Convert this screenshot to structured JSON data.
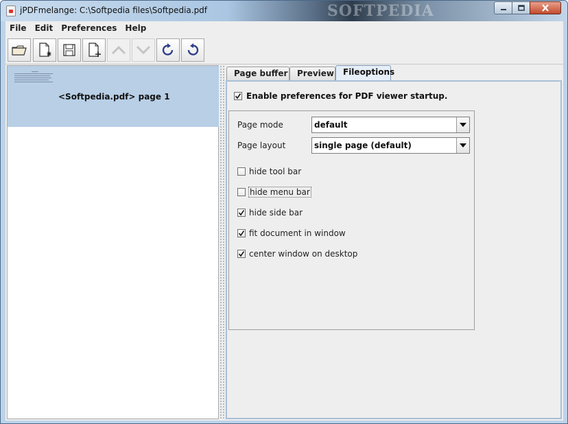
{
  "window": {
    "title": "jPDFmelange: C:\\Softpedia files\\Softpedia.pdf",
    "watermark": "SOFTPEDIA"
  },
  "menu": {
    "items": [
      "File",
      "Edit",
      "Preferences",
      "Help"
    ]
  },
  "toolbar": {
    "buttons": [
      {
        "icon": "open-folder-icon",
        "enabled": true
      },
      {
        "icon": "new-document-icon",
        "enabled": true
      },
      {
        "icon": "save-icon",
        "enabled": true
      },
      {
        "icon": "add-page-icon",
        "enabled": true
      },
      {
        "icon": "move-up-icon",
        "enabled": false
      },
      {
        "icon": "move-down-icon",
        "enabled": false
      },
      {
        "icon": "rotate-right-icon",
        "enabled": true
      },
      {
        "icon": "rotate-left-icon",
        "enabled": true
      }
    ]
  },
  "page_list": {
    "items": [
      {
        "label": "<Softpedia.pdf> page 1",
        "selected": true
      }
    ]
  },
  "tabs": [
    {
      "label": "Page buffer",
      "active": false
    },
    {
      "label": "Preview",
      "active": false
    },
    {
      "label": "Fileoptions",
      "active": true
    }
  ],
  "fileoptions": {
    "enable_label": "Enable preferences for PDF viewer startup.",
    "enable_checked": true,
    "page_mode": {
      "label": "Page mode",
      "value": "default"
    },
    "page_layout": {
      "label": "Page layout",
      "value": "single page (default)"
    },
    "checkboxes": [
      {
        "label": "hide tool bar",
        "checked": false
      },
      {
        "label": "hide menu bar",
        "checked": false
      },
      {
        "label": "hide side bar",
        "checked": true
      },
      {
        "label": "fit document in window",
        "checked": true
      },
      {
        "label": "center window on desktop",
        "checked": true
      }
    ]
  },
  "colors": {
    "selection": "#b8cfe6",
    "tab_border": "#a9bfd6",
    "panel_bg": "#eeeeee"
  }
}
